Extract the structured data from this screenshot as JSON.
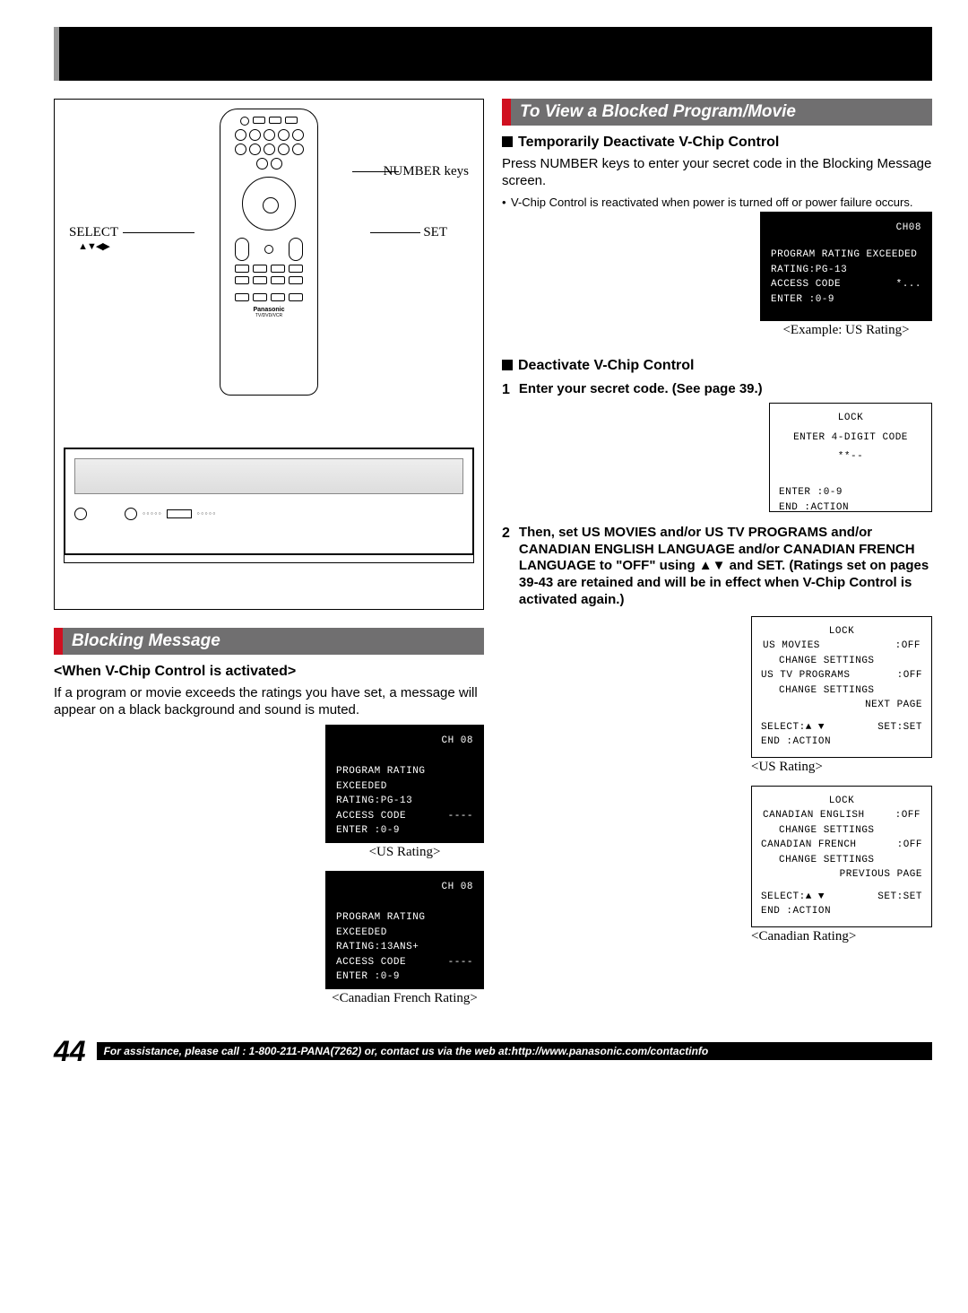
{
  "callouts": {
    "number_keys": "NUMBER keys",
    "select": "SELECT",
    "select_arrows": "▲▼◀▶",
    "set": "SET"
  },
  "remote": {
    "brand": "Panasonic",
    "model": "TV/DVD/VCR"
  },
  "left": {
    "section_title": "Blocking Message",
    "activated_heading": "<When V-Chip Control is activated>",
    "body": "If a program or movie exceeds the ratings you have set, a message will appear on a black background and sound is muted.",
    "osd_us": {
      "ch": "CH 08",
      "line1": "PROGRAM RATING EXCEEDED",
      "line2_label": "RATING:",
      "line2_val": "PG-13",
      "line3_label": "ACCESS CODE",
      "line3_dashes": "----",
      "line4": " ENTER :0-9"
    },
    "caption_us": "<US Rating>",
    "osd_can": {
      "ch": "CH 08",
      "line1": "PROGRAM RATING EXCEEDED",
      "line2_label": "RATING:",
      "line2_val": "13ANS+",
      "line3_label": "ACCESS CODE",
      "line3_dashes": "----",
      "line4": " ENTER :0-9"
    },
    "caption_can": "<Canadian French Rating>"
  },
  "right": {
    "section_title": "To View a Blocked Program/Movie",
    "h1": "Temporarily Deactivate V-Chip Control",
    "p1": "Press NUMBER keys to enter your secret code in the Blocking Message screen.",
    "b1": "V-Chip Control is reactivated when power is turned off or power failure occurs.",
    "osd_top": {
      "ch": "CH08",
      "line1": "PROGRAM RATING EXCEEDED",
      "line2_label": "RATING:",
      "line2_val": "PG-13",
      "line3_label": "ACCESS CODE",
      "line3_stars": "*...",
      "line4": " ENTER :0-9"
    },
    "caption_example": "<Example: US Rating>",
    "h2": "Deactivate V-Chip Control",
    "step1": "Enter your secret code. (See page 39.)",
    "osd_lock": {
      "title": "LOCK",
      "line1": "ENTER 4-DIGIT CODE",
      "line2": "**--",
      "foot1": "ENTER :0-9",
      "foot2": "END   :ACTION"
    },
    "step2": "Then, set US MOVIES and/or US TV PROGRAMS and/or CANADIAN ENGLISH LANGUAGE and/or CANADIAN FRENCH LANGUAGE to \"OFF\" using ▲▼ and SET. (Ratings set on pages 39-43 are retained and will be in effect when V-Chip Control is activated again.)",
    "osd_us_menu": {
      "title": "LOCK",
      "l1a": "US MOVIES",
      "l1b": ":OFF",
      "l2": "CHANGE SETTINGS",
      "l3a": "US TV PROGRAMS",
      "l3b": ":OFF",
      "l4": "CHANGE SETTINGS",
      "l5": "NEXT PAGE",
      "foot1a": "SELECT:▲ ▼",
      "foot1b": "SET:SET",
      "foot2": "END   :ACTION"
    },
    "caption_usmenu": "<US Rating>",
    "osd_can_menu": {
      "title": "LOCK",
      "l1a": "CANADIAN ENGLISH",
      "l1b": ":OFF",
      "l2": "CHANGE SETTINGS",
      "l3a": "CANADIAN FRENCH",
      "l3b": ":OFF",
      "l4": "CHANGE SETTINGS",
      "l5": "PREVIOUS PAGE",
      "foot1a": "SELECT:▲ ▼",
      "foot1b": "SET:SET",
      "foot2": "END   :ACTION"
    },
    "caption_canmenu": "<Canadian Rating>"
  },
  "footer": {
    "page": "44",
    "text": "For assistance, please call : 1-800-211-PANA(7262) or, contact us via the web at:http://www.panasonic.com/contactinfo"
  }
}
